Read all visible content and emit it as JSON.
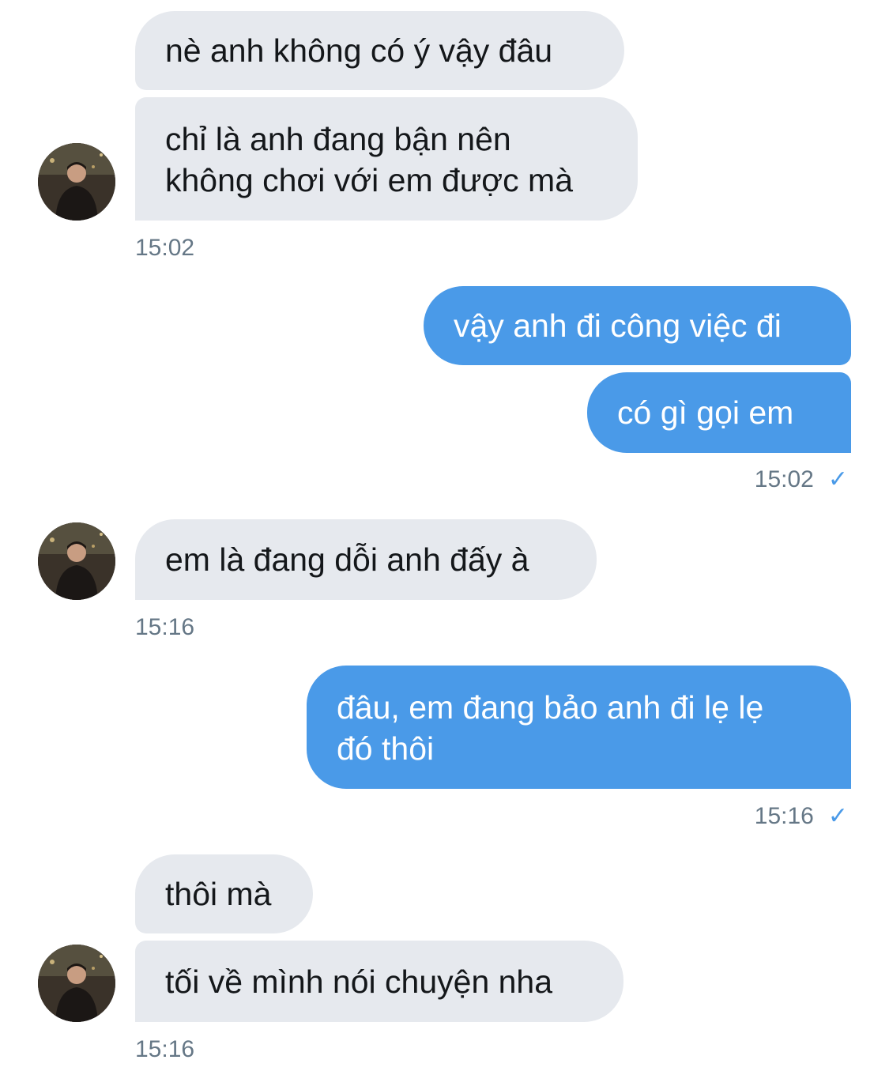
{
  "conversation": {
    "groups": [
      {
        "direction": "incoming",
        "messages": [
          {
            "lines": [
              "nè anh không có ý vậy đâu"
            ]
          },
          {
            "lines": [
              "chỉ là anh đang bận nên",
              "không chơi với em được mà"
            ]
          }
        ],
        "time": "15:02"
      },
      {
        "direction": "outgoing",
        "messages": [
          {
            "lines": [
              "vậy anh đi công việc đi"
            ]
          },
          {
            "lines": [
              "có gì gọi em"
            ]
          }
        ],
        "time": "15:02",
        "status_icon": "read-check-icon"
      },
      {
        "direction": "incoming",
        "messages": [
          {
            "lines": [
              "em là đang dỗi anh đấy à"
            ]
          }
        ],
        "time": "15:16"
      },
      {
        "direction": "outgoing",
        "messages": [
          {
            "lines": [
              "đâu, em đang bảo anh đi lẹ lẹ",
              "đó thôi"
            ]
          }
        ],
        "time": "15:16",
        "status_icon": "read-check-icon"
      },
      {
        "direction": "incoming",
        "messages": [
          {
            "lines": [
              "thôi mà"
            ]
          },
          {
            "lines": [
              "tối về mình nói chuyện nha"
            ]
          }
        ],
        "time": "15:16"
      }
    ],
    "check_glyph": "✓"
  },
  "colors": {
    "incoming_bubble": "#e6e9ee",
    "outgoing_bubble": "#4a9ae8",
    "timestamp": "#657786"
  }
}
